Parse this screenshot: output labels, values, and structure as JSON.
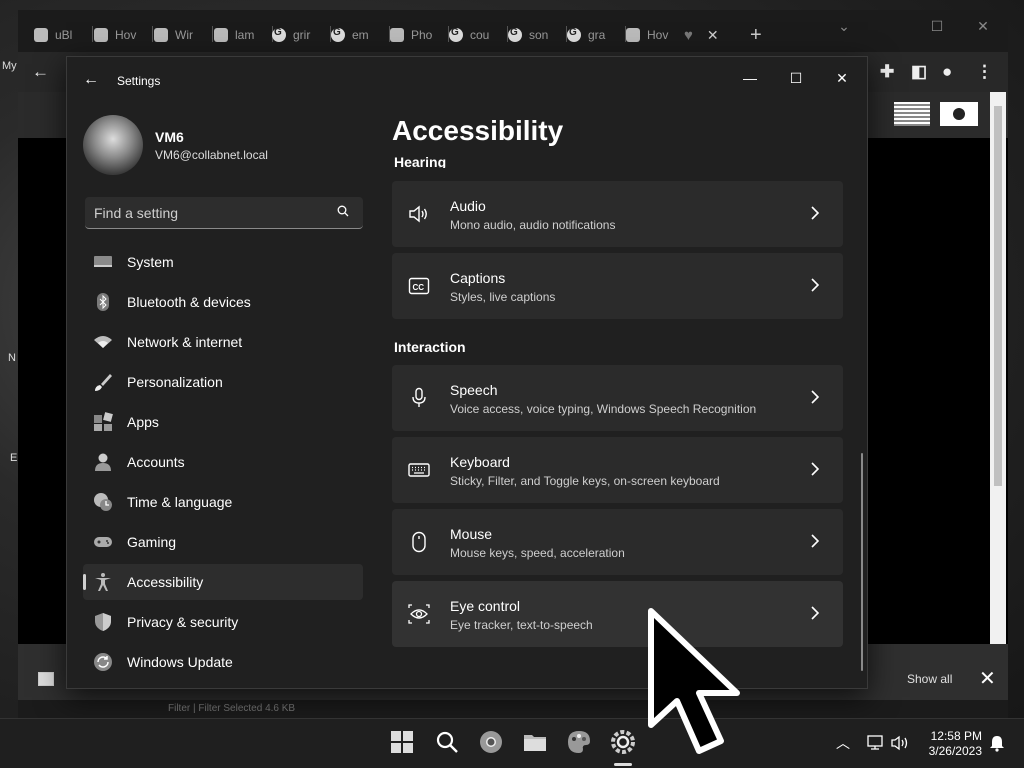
{
  "desktop": {
    "labels": [
      "My",
      "N",
      "E"
    ]
  },
  "browser": {
    "tabs": [
      {
        "label": "uBl",
        "icon": "ublock-icon"
      },
      {
        "label": "Hov",
        "icon": "site-icon"
      },
      {
        "label": "Wir",
        "icon": "site-icon"
      },
      {
        "label": "lam",
        "icon": "site-icon"
      },
      {
        "label": "grir",
        "icon": "google-icon"
      },
      {
        "label": "em",
        "icon": "google-icon"
      },
      {
        "label": "Pho",
        "icon": "site-icon"
      },
      {
        "label": "cou",
        "icon": "google-icon"
      },
      {
        "label": "son",
        "icon": "google-icon"
      },
      {
        "label": "gra",
        "icon": "google-icon"
      },
      {
        "label": "Hov",
        "icon": "site-icon"
      }
    ],
    "new_tab_label": "+",
    "download_bar": {
      "show_all": "Show all"
    },
    "status": "Filter  |  Filter Selected  4.6 KB"
  },
  "settings": {
    "window_title": "Settings",
    "user": {
      "name": "VM6",
      "email": "VM6@collabnet.local"
    },
    "search_placeholder": "Find a setting",
    "nav": [
      {
        "label": "System",
        "icon": "system-icon"
      },
      {
        "label": "Bluetooth & devices",
        "icon": "bluetooth-icon"
      },
      {
        "label": "Network & internet",
        "icon": "wifi-icon"
      },
      {
        "label": "Personalization",
        "icon": "brush-icon"
      },
      {
        "label": "Apps",
        "icon": "apps-icon"
      },
      {
        "label": "Accounts",
        "icon": "person-icon"
      },
      {
        "label": "Time & language",
        "icon": "clock-globe-icon"
      },
      {
        "label": "Gaming",
        "icon": "gamepad-icon"
      },
      {
        "label": "Accessibility",
        "icon": "accessibility-icon",
        "active": true
      },
      {
        "label": "Privacy & security",
        "icon": "shield-icon"
      },
      {
        "label": "Windows Update",
        "icon": "update-icon"
      }
    ],
    "page_title": "Accessibility",
    "section_hearing": "Hearing",
    "section_interaction": "Interaction",
    "hearing_cards": [
      {
        "title": "Audio",
        "subtitle": "Mono audio, audio notifications",
        "icon": "speaker-icon"
      },
      {
        "title": "Captions",
        "subtitle": "Styles, live captions",
        "icon": "cc-icon"
      }
    ],
    "interaction_cards": [
      {
        "title": "Speech",
        "subtitle": "Voice access, voice typing, Windows Speech Recognition",
        "icon": "microphone-icon"
      },
      {
        "title": "Keyboard",
        "subtitle": "Sticky, Filter, and Toggle keys, on-screen keyboard",
        "icon": "keyboard-icon"
      },
      {
        "title": "Mouse",
        "subtitle": "Mouse keys, speed, acceleration",
        "icon": "mouse-icon"
      },
      {
        "title": "Eye control",
        "subtitle": "Eye tracker, text-to-speech",
        "icon": "eye-icon"
      }
    ]
  },
  "taskbar": {
    "time": "12:58 PM",
    "date": "3/26/2023",
    "apps": [
      "start-icon",
      "search-icon",
      "chrome-icon",
      "file-explorer-icon",
      "paint-icon",
      "settings-icon"
    ]
  }
}
